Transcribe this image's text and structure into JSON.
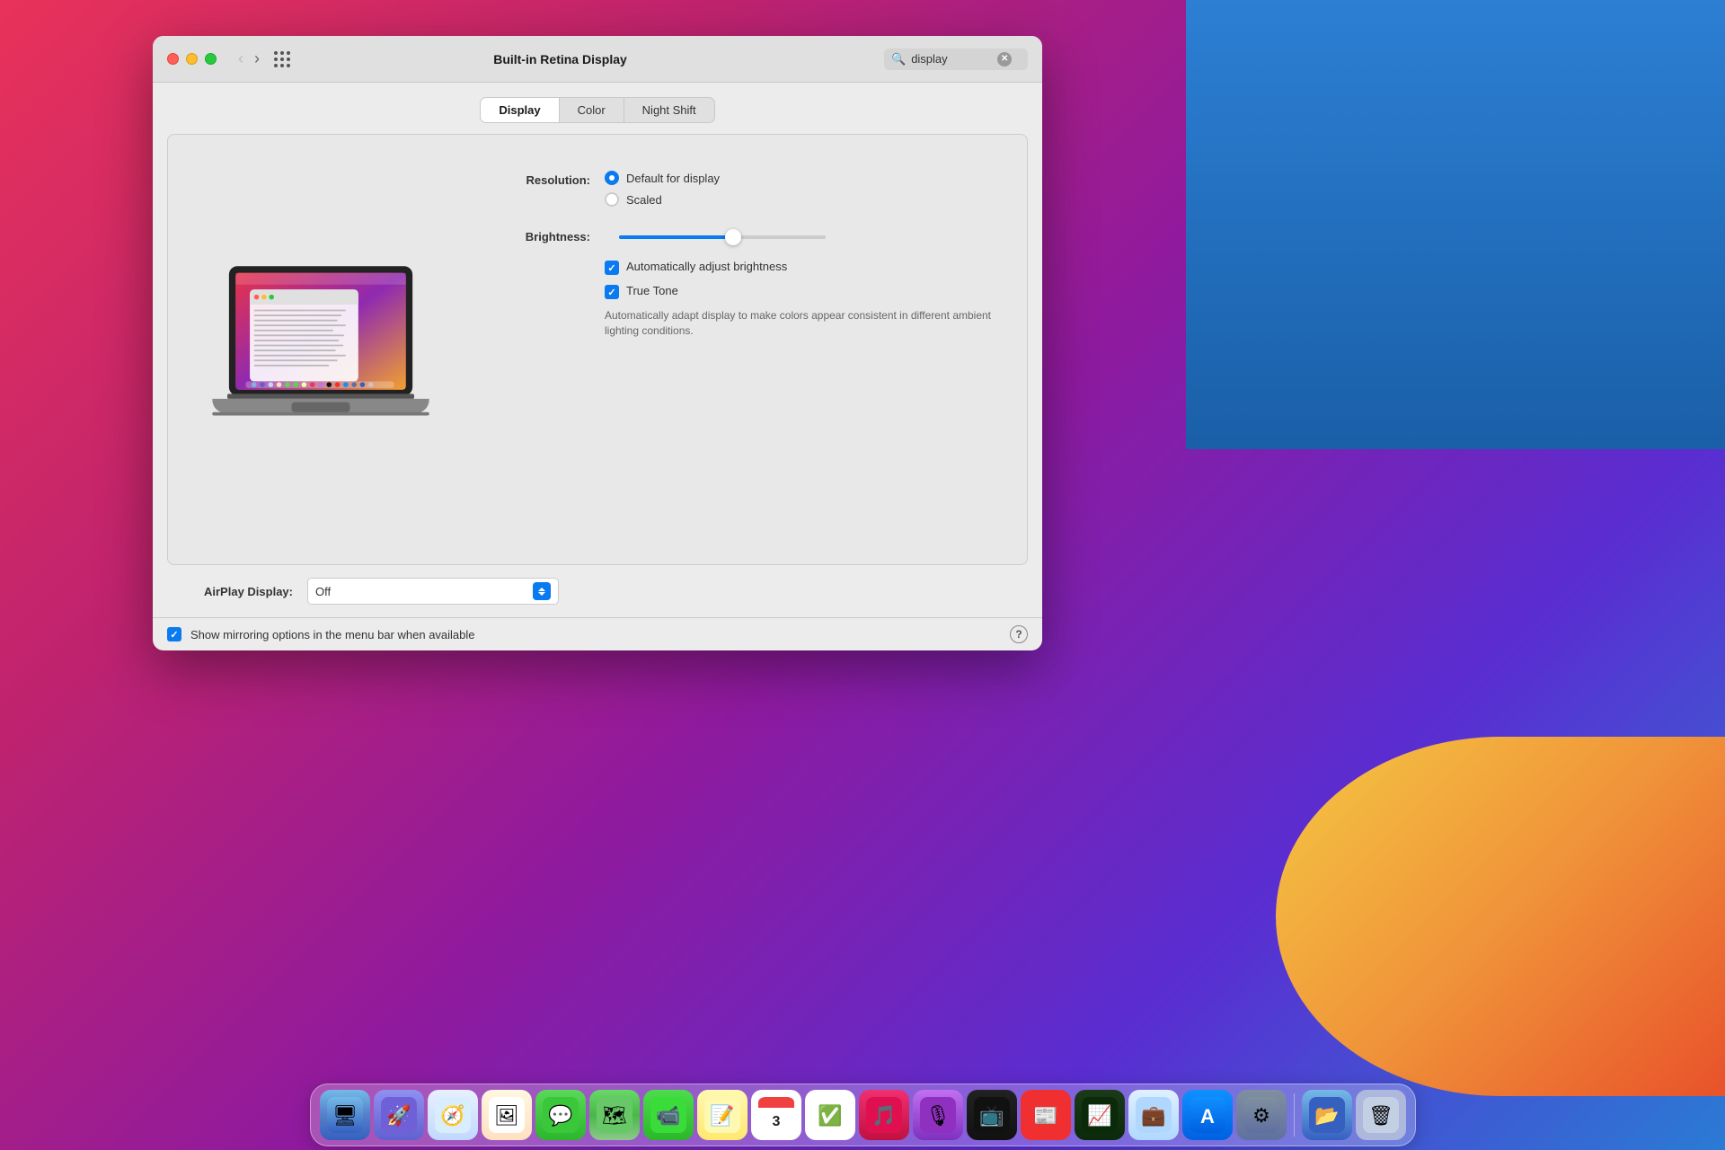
{
  "background": {
    "gradient_left": "#e8325a",
    "gradient_right": "#2a7bd4"
  },
  "window": {
    "title": "Built-in Retina Display",
    "traffic_lights": {
      "close": "close",
      "minimize": "minimize",
      "maximize": "maximize"
    },
    "search": {
      "placeholder": "display",
      "value": "display"
    },
    "tabs": [
      {
        "id": "display",
        "label": "Display",
        "active": true
      },
      {
        "id": "color",
        "label": "Color",
        "active": false
      },
      {
        "id": "night-shift",
        "label": "Night Shift",
        "active": false
      }
    ],
    "display_tab": {
      "resolution_label": "Resolution:",
      "resolution_options": [
        {
          "id": "default",
          "label": "Default for display",
          "selected": true
        },
        {
          "id": "scaled",
          "label": "Scaled",
          "selected": false
        }
      ],
      "brightness_label": "Brightness:",
      "brightness_value": 55,
      "auto_brightness_label": "Automatically adjust brightness",
      "auto_brightness_checked": true,
      "true_tone_label": "True Tone",
      "true_tone_checked": true,
      "true_tone_description": "Automatically adapt display to make colors appear consistent in different ambient lighting conditions."
    },
    "airplay": {
      "label": "AirPlay Display:",
      "value": "Off",
      "options": [
        "Off"
      ]
    },
    "mirroring": {
      "label": "Show mirroring options in the menu bar when available",
      "checked": true
    },
    "help_button": "?"
  },
  "dock": {
    "items": [
      {
        "name": "finder",
        "icon": "🖥",
        "label": "Finder"
      },
      {
        "name": "launchpad",
        "icon": "🚀",
        "label": "Launchpad"
      },
      {
        "name": "safari",
        "icon": "🧭",
        "label": "Safari"
      },
      {
        "name": "photos",
        "icon": "🖼",
        "label": "Photos"
      },
      {
        "name": "messages",
        "icon": "💬",
        "label": "Messages"
      },
      {
        "name": "maps",
        "icon": "🗺",
        "label": "Maps"
      },
      {
        "name": "facetime",
        "icon": "📹",
        "label": "FaceTime"
      },
      {
        "name": "notes",
        "icon": "📝",
        "label": "Notes"
      },
      {
        "name": "calendar",
        "icon": "📅",
        "label": "Calendar"
      },
      {
        "name": "reminders",
        "icon": "✅",
        "label": "Reminders"
      },
      {
        "name": "music",
        "icon": "🎵",
        "label": "Music"
      },
      {
        "name": "podcasts",
        "icon": "🎙",
        "label": "Podcasts"
      },
      {
        "name": "appletv",
        "icon": "📺",
        "label": "Apple TV"
      },
      {
        "name": "news",
        "icon": "📰",
        "label": "News"
      },
      {
        "name": "stocks",
        "icon": "📈",
        "label": "Stocks"
      },
      {
        "name": "iwork",
        "icon": "💼",
        "label": "iWork"
      },
      {
        "name": "appstore",
        "icon": "🅰",
        "label": "App Store"
      },
      {
        "name": "syspreferences",
        "icon": "⚙",
        "label": "System Preferences"
      },
      {
        "name": "finder2",
        "icon": "📂",
        "label": "Finder"
      },
      {
        "name": "trash",
        "icon": "🗑",
        "label": "Trash"
      }
    ]
  }
}
